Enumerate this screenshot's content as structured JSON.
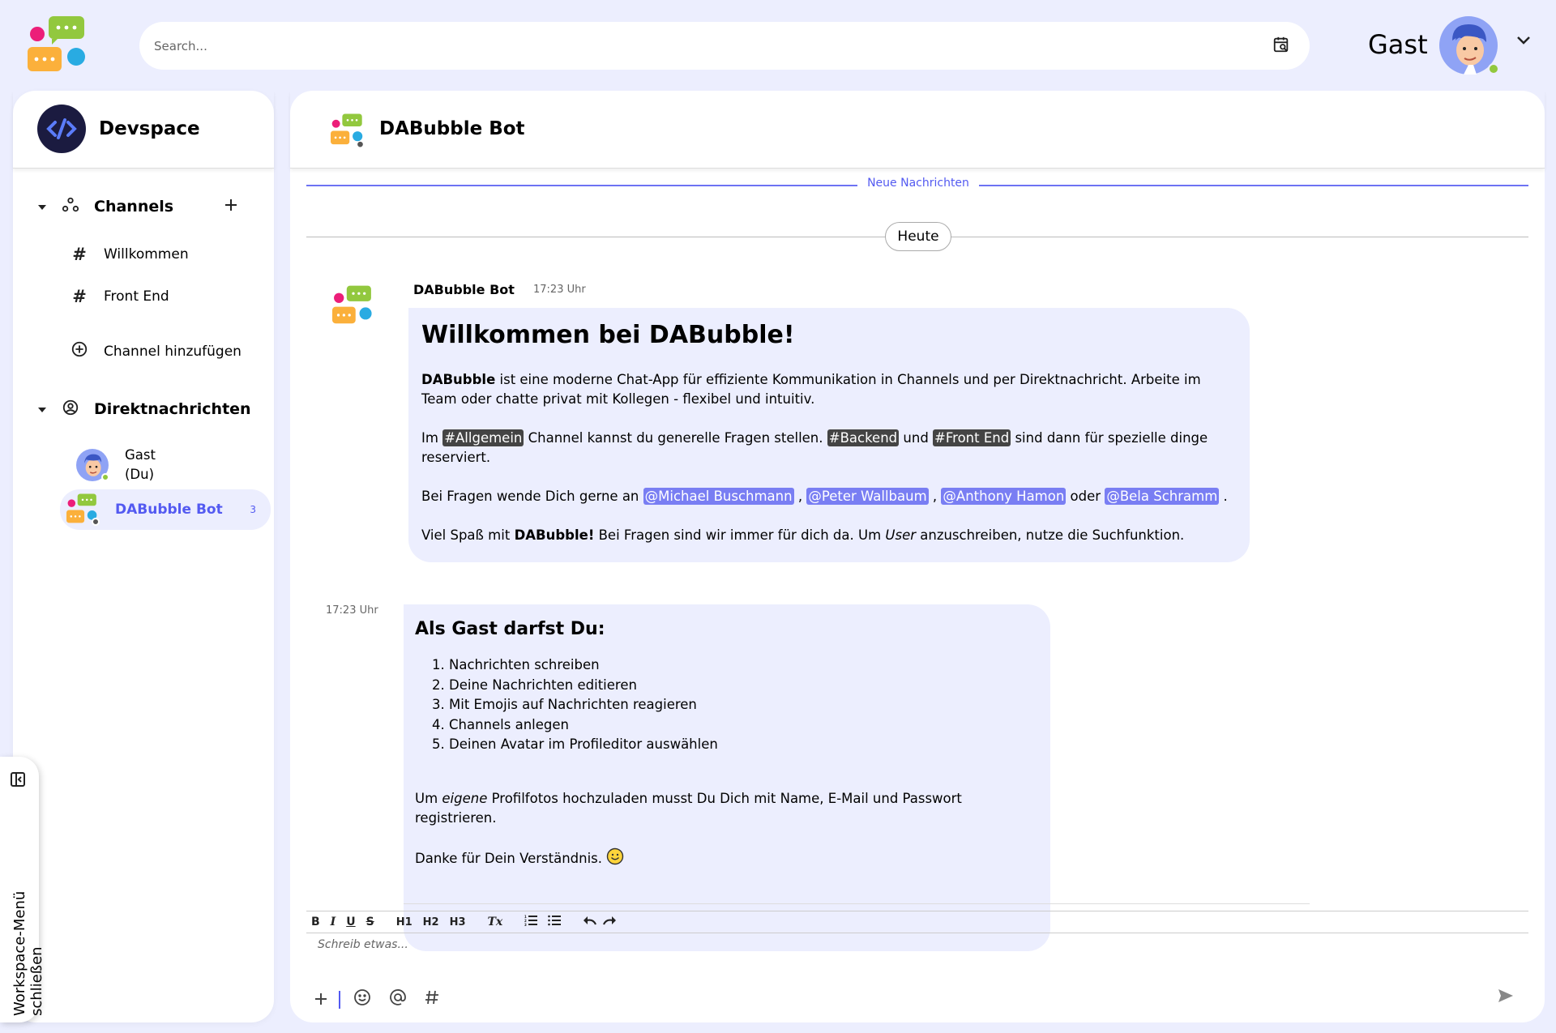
{
  "header": {
    "search_placeholder": "Search...",
    "user_name": "Gast"
  },
  "sidebar": {
    "workspace_name": "Devspace",
    "channels_label": "Channels",
    "channels": [
      {
        "label": "Willkommen"
      },
      {
        "label": "Front End"
      }
    ],
    "add_channel_label": "Channel hinzufügen",
    "dm_label": "Direktnachrichten",
    "dms": [
      {
        "line1": "Gast",
        "line2": "(Du)"
      },
      {
        "label": "DABubble Bot",
        "badge": "3"
      }
    ],
    "toggle_label": "Workspace-Menü schließen"
  },
  "chat": {
    "title": "DABubble Bot",
    "new_messages_label": "Neue Nachrichten",
    "day_label": "Heute",
    "messages": [
      {
        "sender": "DABubble Bot",
        "time": "17:23 Uhr",
        "heading": "Willkommen bei DABubble!",
        "p1_bold": "DABubble",
        "p1_rest": " ist eine moderne Chat-App für effiziente Kommunikation in Channels und per Direktnachricht. Arbeite im Team oder chatte privat mit Kollegen - flexibel und intuitiv.",
        "p2_a": "Im ",
        "tag1": "#Allgemein",
        "p2_b": " Channel kannst du generelle Fragen stellen. ",
        "tag2": "#Backend",
        "p2_c": " und ",
        "tag3": "#Front End",
        "p2_d": " sind dann für spezielle dinge reserviert.",
        "p3_a": "Bei Fragen wende Dich gerne an ",
        "mention1": "@Michael Buschmann",
        "sep1": " , ",
        "mention2": "@Peter Wallbaum",
        "sep2": " , ",
        "mention3": "@Anthony Hamon",
        "p3_or": " oder ",
        "mention4": "@Bela Schramm",
        "p3_end": " .",
        "p4_a": "Viel Spaß mit ",
        "p4_bold": "DABubble!",
        "p4_b": " Bei Fragen sind wir immer für dich da. Um ",
        "p4_italic": "User",
        "p4_c": " anzuschreiben, nutze die Suchfunktion."
      },
      {
        "time": "17:23 Uhr",
        "heading": "Als Gast darfst Du:",
        "list": [
          "Nachrichten schreiben",
          "Deine Nachrichten editieren",
          "Mit Emojis auf Nachrichten reagieren",
          "Channels anlegen",
          "Deinen Avatar im Profileditor auswählen"
        ],
        "p1_a": "Um ",
        "p1_italic": "eigene",
        "p1_b": " Profilfotos hochzuladen musst Du Dich mit Name, E-Mail und Passwort registrieren.",
        "p2": "Danke für Dein Verständnis."
      }
    ]
  },
  "editor": {
    "placeholder": "Schreib etwas...",
    "toolbar": [
      "B",
      "I",
      "U",
      "S",
      "H1",
      "H2",
      "H3",
      "Tx"
    ]
  },
  "colors": {
    "background": "#ECEEFE",
    "accent": "#535AF1",
    "mention": "#797EF3",
    "online": "#92C83E",
    "logo_pink": "#EC1E79",
    "logo_green": "#92C83E",
    "logo_orange": "#FBB03B",
    "logo_blue": "#29ABE2"
  }
}
